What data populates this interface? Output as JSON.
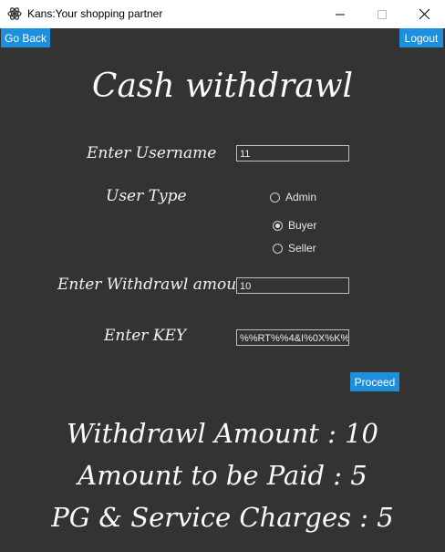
{
  "window": {
    "title": "Kans:Your shopping partner"
  },
  "nav": {
    "go_back": "Go Back",
    "logout": "Logout"
  },
  "page": {
    "heading": "Cash withdrawl"
  },
  "form": {
    "username_label": "Enter Username",
    "username_value": "11",
    "user_type_label": "User Type",
    "user_types": [
      "Admin",
      "Buyer",
      "Seller"
    ],
    "user_type_selected": "Buyer",
    "amount_label": "Enter Withdrawl amount",
    "amount_value": "10",
    "key_label": "Enter KEY",
    "key_value": "%%RT%%4&I%0X%K%",
    "proceed": "Proceed"
  },
  "summary": {
    "withdrawl_amount": "Withdrawl Amount : 10",
    "amount_to_be_paid": "Amount to be Paid : 5",
    "charges": "PG & Service Charges : 5"
  },
  "colors": {
    "background": "#333333",
    "button": "#1e8fdc",
    "text": "#fafafa"
  }
}
